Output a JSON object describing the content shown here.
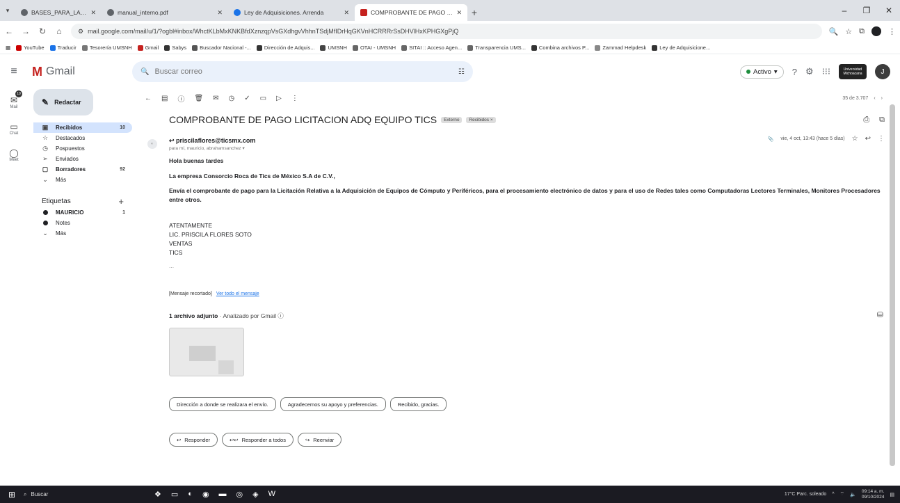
{
  "browser": {
    "tabs": [
      {
        "title": "BASES_PARA_LA_LICITACION_",
        "color": "#5f6368",
        "active": false
      },
      {
        "title": "manual_interno.pdf",
        "color": "#5f6368",
        "active": false
      },
      {
        "title": "Ley de Adquisiciones. Arrenda",
        "color": "#1a73e8",
        "active": false
      },
      {
        "title": "COMPROBANTE DE PAGO LIC",
        "color": "#c5221f",
        "active": true
      }
    ],
    "url": "mail.google.com/mail/u/1/?ogbl#inbox/WhctKLbMxKNKBfdXznzqpVsGXdhgvVhhnTSdjMfIDrHqGKVnHCRRRrSsDHVlHxKPHGXgPjQ",
    "bookmarks": [
      "YouTube",
      "Traducir",
      "Tesorería UMSNH",
      "Gmail",
      "Sabys",
      "Buscador Nacional -...",
      "Dirección de Adquis...",
      "UMSNH",
      "OTAI - UMSNH",
      "SITAI :: Acceso Agen...",
      "Transparencia UMS...",
      "Combina archivos P...",
      "Zammad Helpdesk",
      "Ley de Adquisicione..."
    ]
  },
  "gmail": {
    "app_name": "Gmail",
    "search_placeholder": "Buscar correo",
    "status": "Activo",
    "avatar_initial": "J",
    "org_label": "Universidad Michoacana",
    "rail": [
      {
        "label": "Mail",
        "icon": "mail-icon"
      },
      {
        "label": "Chat",
        "icon": "chat-icon"
      },
      {
        "label": "Meet",
        "icon": "meet-icon"
      }
    ],
    "rail_badge": "10",
    "compose": "Redactar",
    "nav": [
      {
        "label": "Recibidos",
        "icon": "inbox-icon",
        "count": "10",
        "active": true
      },
      {
        "label": "Destacados",
        "icon": "star-icon",
        "count": "",
        "active": false
      },
      {
        "label": "Pospuestos",
        "icon": "clock-icon",
        "count": "",
        "active": false
      },
      {
        "label": "Enviados",
        "icon": "send-icon",
        "count": "",
        "active": false
      },
      {
        "label": "Borradores",
        "icon": "draft-icon",
        "count": "92",
        "active": false
      },
      {
        "label": "Más",
        "icon": "chevron-down-icon",
        "count": "",
        "active": false
      }
    ],
    "labels_title": "Etiquetas",
    "labels": [
      {
        "label": "MAURICIO",
        "count": "1"
      },
      {
        "label": "Notes",
        "count": ""
      },
      {
        "label": "Más",
        "count": ""
      }
    ],
    "pager": "35 de 3.707"
  },
  "email": {
    "subject": "COMPROBANTE DE PAGO LICITACION ADQ EQUIPO TICS",
    "chip_external": "Externo",
    "chip_inbox": "Recibidos ×",
    "sender": "priscilaflores@ticsmx.com",
    "to_line": "para mí, mauricio, abrahamsanchez ▾",
    "date": "vie, 4 oct, 13:43 (hace 5 días)",
    "body": {
      "greeting": "Hola buenas tardes",
      "company": "La empresa Consorcio Roca de Tics de México S.A de C.V.,",
      "paragraph": "Envía el comprobante de pago para la Licitación Relativa a la Adquisición de Equipos de Cómputo y Periféricos, para el procesamiento electrónico de datos y para el uso de Redes tales como Computadoras Lectores Terminales, Monitores Procesadores entre otros.",
      "sign1": "ATENTAMENTE",
      "sign2": "LIC. PRISCILA FLORES SOTO",
      "sign3": "VENTAS",
      "sign4": "TICS",
      "ellipsis": "..."
    },
    "truncated": "[Mensaje recortado]",
    "view_all": "Ver todo el mensaje",
    "attachments_count": "1 archivo adjunto",
    "scanned": "· Analizado por Gmail ⓘ",
    "smart_replies": [
      "Dirección a donde se realizara el envío.",
      "Agradecemos su apoyo y preferencias.",
      "Recibido, gracias."
    ],
    "actions": {
      "reply": "Responder",
      "reply_all": "Responder a todos",
      "forward": "Reenviar"
    }
  },
  "taskbar": {
    "search": "Buscar",
    "weather": "17°C  Parc. soleado",
    "time": "09:14 a. m.",
    "date": "09/10/2024"
  }
}
